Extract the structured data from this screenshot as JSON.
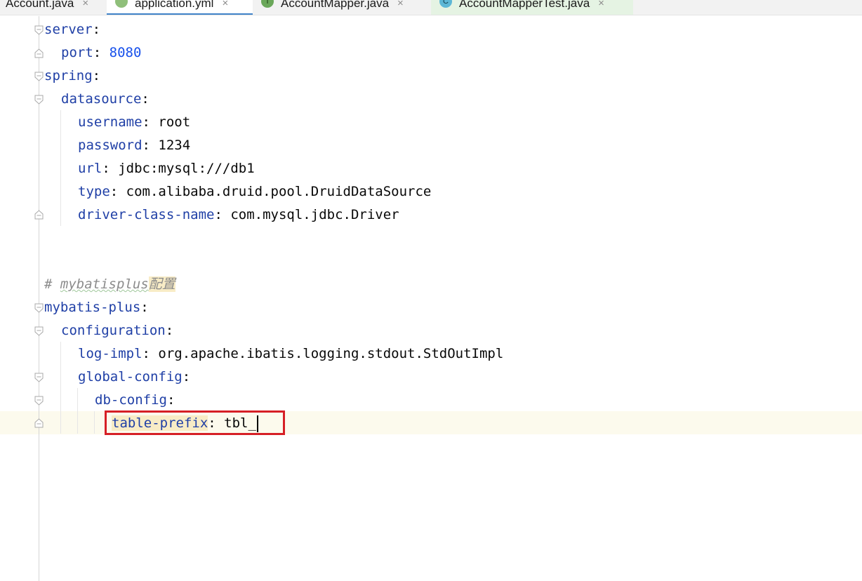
{
  "tabs": [
    {
      "label": "Account.java",
      "icon": "java-class-icon",
      "close": "×"
    },
    {
      "label": "application.yml",
      "icon": "spring-yaml-icon",
      "close": "×"
    },
    {
      "label": "AccountMapper.java",
      "icon": "interface-icon",
      "icon_letter": "I",
      "close": "×"
    },
    {
      "label": "AccountMapperTest.java",
      "icon": "class-icon",
      "icon_letter": "C",
      "close": "×"
    }
  ],
  "editor": {
    "lines": [
      {
        "key": "server",
        "sep": ":"
      },
      {
        "key": "port",
        "sep": ": ",
        "value": "8080"
      },
      {
        "key": "spring",
        "sep": ":"
      },
      {
        "key": "datasource",
        "sep": ":"
      },
      {
        "key": "username",
        "sep": ": ",
        "value": "root"
      },
      {
        "key": "password",
        "sep": ": ",
        "value": "1234"
      },
      {
        "key": "url",
        "sep": ": ",
        "value": "jdbc:mysql:///db1"
      },
      {
        "key": "type",
        "sep": ": ",
        "value": "com.alibaba.druid.pool.DruidDataSource"
      },
      {
        "key": "driver-class-name",
        "sep": ": ",
        "value": "com.mysql.jdbc.Driver"
      },
      {
        "comment_hash": "# ",
        "comment_word": "mybatisplus",
        "comment_cjk": "配置"
      },
      {
        "key": "mybatis-plus",
        "sep": ":"
      },
      {
        "key": "configuration",
        "sep": ":"
      },
      {
        "key": "log-impl",
        "sep": ": ",
        "value": "org.apache.ibatis.logging.stdout.StdOutImpl"
      },
      {
        "key": "global-config",
        "sep": ":"
      },
      {
        "key": "db-config",
        "sep": ":"
      },
      {
        "key": "table-prefix",
        "sep": ": ",
        "value": "tbl_"
      }
    ]
  },
  "colors": {
    "key": "#1f3fa6",
    "number": "#1750eb",
    "comment": "#8c8c8c",
    "highlight_box": "#d61f26",
    "active_tab_underline": "#4083c9"
  }
}
